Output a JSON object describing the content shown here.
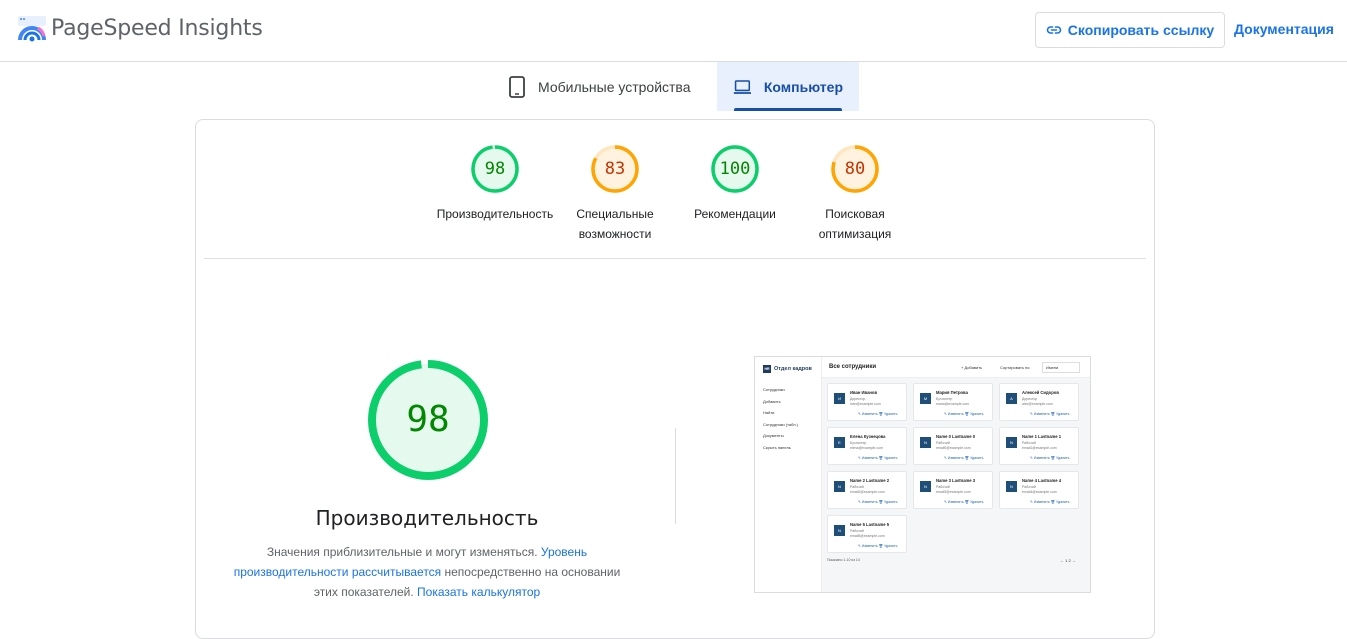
{
  "header": {
    "title": "PageSpeed Insights",
    "copy_link": "Скопировать ссылку",
    "docs": "Документация"
  },
  "tabs": [
    {
      "label": "Мобильные устройства",
      "icon": "smartphone-icon",
      "selected": false
    },
    {
      "label": "Компьютер",
      "icon": "laptop-icon",
      "selected": true
    }
  ],
  "colors": {
    "pass": "#0cce6b",
    "pass_text": "#008800",
    "average": "#ffa400",
    "average_text": "#c33300",
    "link": "#1a73e8"
  },
  "scores": [
    {
      "value": "98",
      "label_lines": [
        "Производительность"
      ],
      "score": 0.98,
      "rating": "pass"
    },
    {
      "value": "83",
      "label_lines": [
        "Специальные",
        "возможности"
      ],
      "score": 0.83,
      "rating": "average"
    },
    {
      "value": "100",
      "label_lines": [
        "Рекомендации"
      ],
      "score": 1.0,
      "rating": "pass"
    },
    {
      "value": "80",
      "label_lines": [
        "Поисковая",
        "оптимизация"
      ],
      "score": 0.8,
      "rating": "average"
    }
  ],
  "performance": {
    "value": "98",
    "score": 0.98,
    "title": "Производительность",
    "note_start": "Значения приблизительные и могут изменяться. ",
    "note_link1": "Уровень производительности рассчитывается",
    "note_mid": " непосредственно на основании этих показателей. ",
    "note_link2": "Показать калькулятор"
  },
  "screenshot": {
    "brand": "Отдел кадров",
    "brand_badge": "HR",
    "nav": [
      "Сотрудники",
      "Добавить",
      "Найти",
      "Сотрудники (табл.)",
      "Документы",
      "Скрыть панель"
    ],
    "heading": "Все сотрудники",
    "add": "+ Добавить",
    "sort_label": "Сортировать по:",
    "sort_value": "Имени",
    "cards": [
      {
        "initial": "И",
        "name": "Иван Иванов",
        "role": "Директор",
        "email": "ivan@example.com"
      },
      {
        "initial": "М",
        "name": "Мария Петрова",
        "role": "Бухгалтер",
        "email": "maria@example.com"
      },
      {
        "initial": "А",
        "name": "Алексей Сидоров",
        "role": "Директор",
        "email": "alex@example.com"
      },
      {
        "initial": "Е",
        "name": "Елена Кузнецова",
        "role": "Бухгалтер",
        "email": "elena@example.com"
      },
      {
        "initial": "N",
        "name": "Name 0 Lastname 0",
        "role": "Рабочий",
        "email": "email0@example.com"
      },
      {
        "initial": "N",
        "name": "Name 1 Lastname 1",
        "role": "Рабочий",
        "email": "email1@example.com"
      },
      {
        "initial": "N",
        "name": "Name 2 Lastname 2",
        "role": "Рабочий",
        "email": "email2@example.com"
      },
      {
        "initial": "N",
        "name": "Name 3 Lastname 3",
        "role": "Рабочий",
        "email": "email3@example.com"
      },
      {
        "initial": "N",
        "name": "Name 4 Lastname 4",
        "role": "Рабочий",
        "email": "email4@example.com"
      },
      {
        "initial": "N",
        "name": "Name 5 Lastname 5",
        "role": "Рабочий",
        "email": "email5@example.com"
      }
    ],
    "card_actions": "✎ Изменить  🗑 Удалить",
    "footer": "Показано 1-10 из 14",
    "pager": "← 1 2 →"
  }
}
